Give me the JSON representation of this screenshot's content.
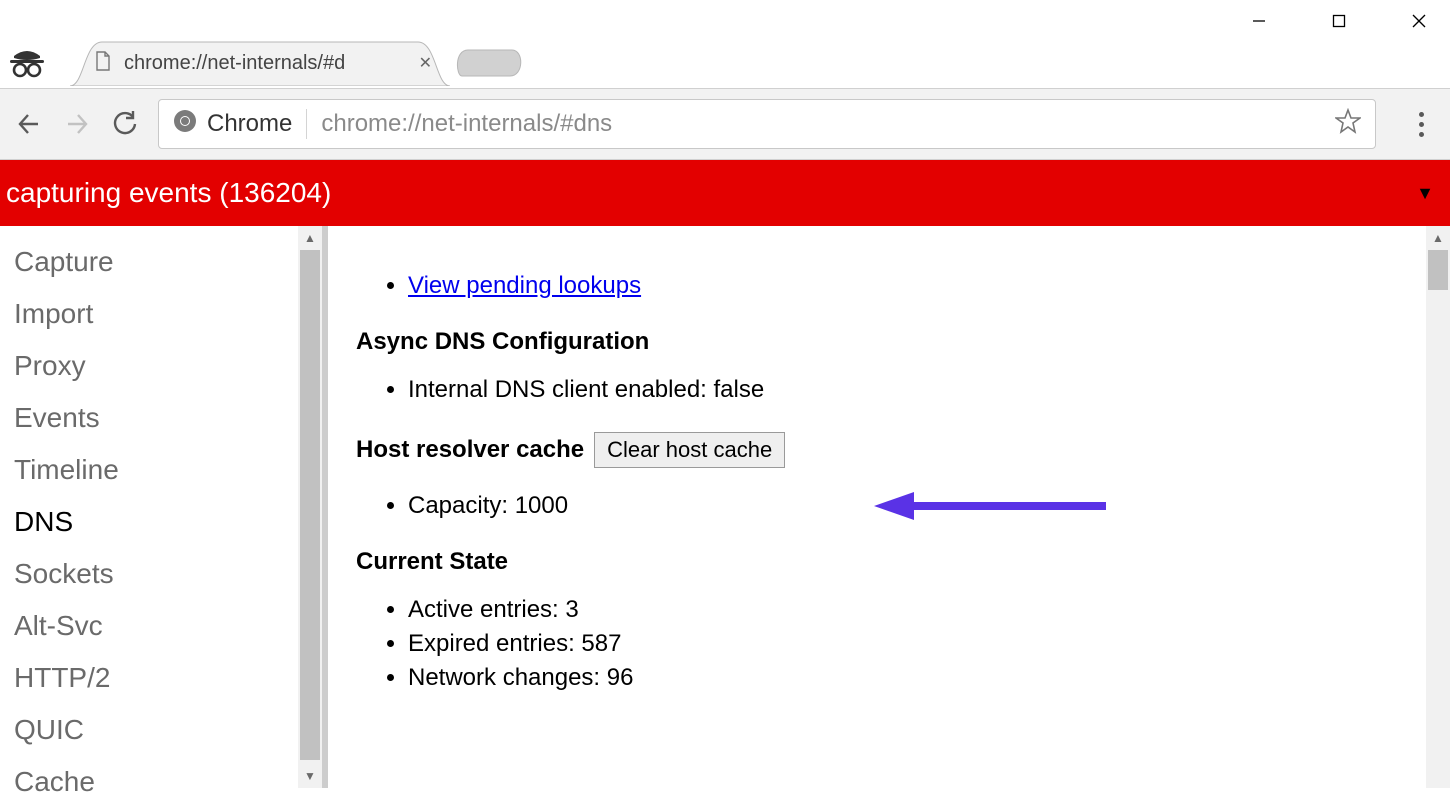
{
  "window": {
    "tab_title": "chrome://net-internals/#d"
  },
  "toolbar": {
    "chip_label": "Chrome",
    "url": "chrome://net-internals/#dns"
  },
  "banner": {
    "text": "capturing events (136204)"
  },
  "sidebar": {
    "items": [
      {
        "label": "Capture"
      },
      {
        "label": "Import"
      },
      {
        "label": "Proxy"
      },
      {
        "label": "Events"
      },
      {
        "label": "Timeline"
      },
      {
        "label": "DNS"
      },
      {
        "label": "Sockets"
      },
      {
        "label": "Alt-Svc"
      },
      {
        "label": "HTTP/2"
      },
      {
        "label": "QUIC"
      },
      {
        "label": "Cache"
      }
    ],
    "active_index": 5
  },
  "main": {
    "link_pending": "View pending lookups",
    "async_heading": "Async DNS Configuration",
    "async_item": "Internal DNS client enabled: false",
    "cache_heading": "Host resolver cache",
    "clear_button": "Clear host cache",
    "capacity": "Capacity: 1000",
    "state_heading": "Current State",
    "state_active": "Active entries: 3",
    "state_expired": "Expired entries: 587",
    "state_network": "Network changes: 96"
  }
}
